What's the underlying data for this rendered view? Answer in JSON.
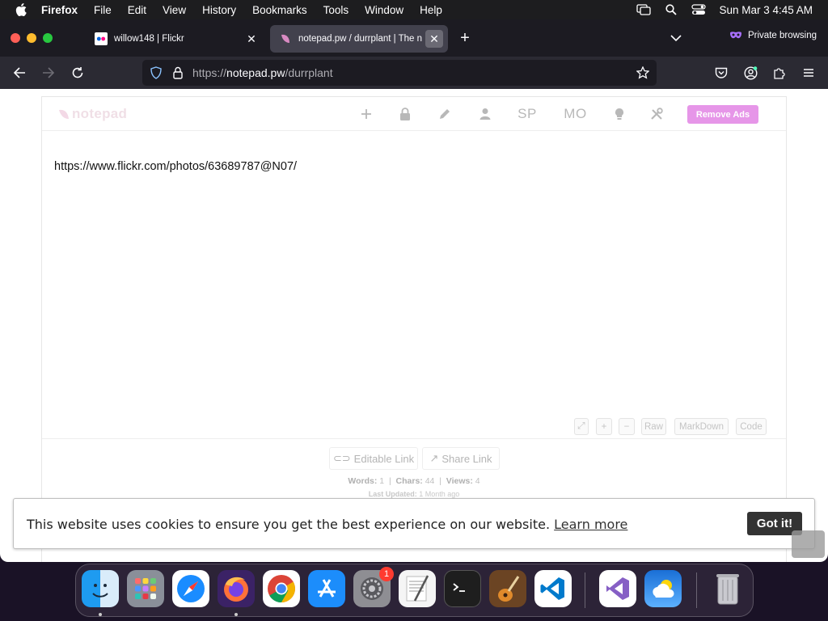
{
  "menubar": {
    "app_name": "Firefox",
    "items": [
      "File",
      "Edit",
      "View",
      "History",
      "Bookmarks",
      "Tools",
      "Window",
      "Help"
    ],
    "clock": "Sun Mar 3  4:45 AM"
  },
  "tabs": [
    {
      "title": "willow148 | Flickr",
      "active": false
    },
    {
      "title": "notepad.pw / durrplant | The n",
      "active": true
    }
  ],
  "private_label": "Private browsing",
  "url": {
    "prefix": "https://",
    "domain": "notepad.pw",
    "path": "/durrplant"
  },
  "notepad": {
    "logo": "notepad",
    "toolbar": {
      "sp": "SP",
      "mo": "MO",
      "remove_ads": "Remove Ads"
    },
    "content": "https://www.flickr.com/photos/63689787@N07/",
    "view_buttons": {
      "expand": "⤢",
      "plus": "+",
      "minus": "−",
      "raw": "Raw",
      "markdown": "MarkDown",
      "code": "Code"
    },
    "footer": {
      "editable_link": "Editable Link",
      "share_link": "Share Link",
      "words_label": "Words:",
      "words": "1",
      "chars_label": "Chars:",
      "chars": "44",
      "views_label": "Views:",
      "views": "4",
      "updated_label": "Last Updated:",
      "updated": "1 Month ago"
    }
  },
  "cookie": {
    "message": "This website uses cookies to ensure you get the best experience on our website.",
    "learn_more": "Learn more",
    "accept": "Got it!"
  },
  "dock": {
    "apps": [
      "finder",
      "launchpad",
      "safari",
      "firefox",
      "chrome",
      "app-store",
      "system-settings",
      "textedit",
      "terminal",
      "garageband",
      "vscode",
      "visual-studio",
      "weather",
      "trash"
    ],
    "settings_badge": "1"
  }
}
